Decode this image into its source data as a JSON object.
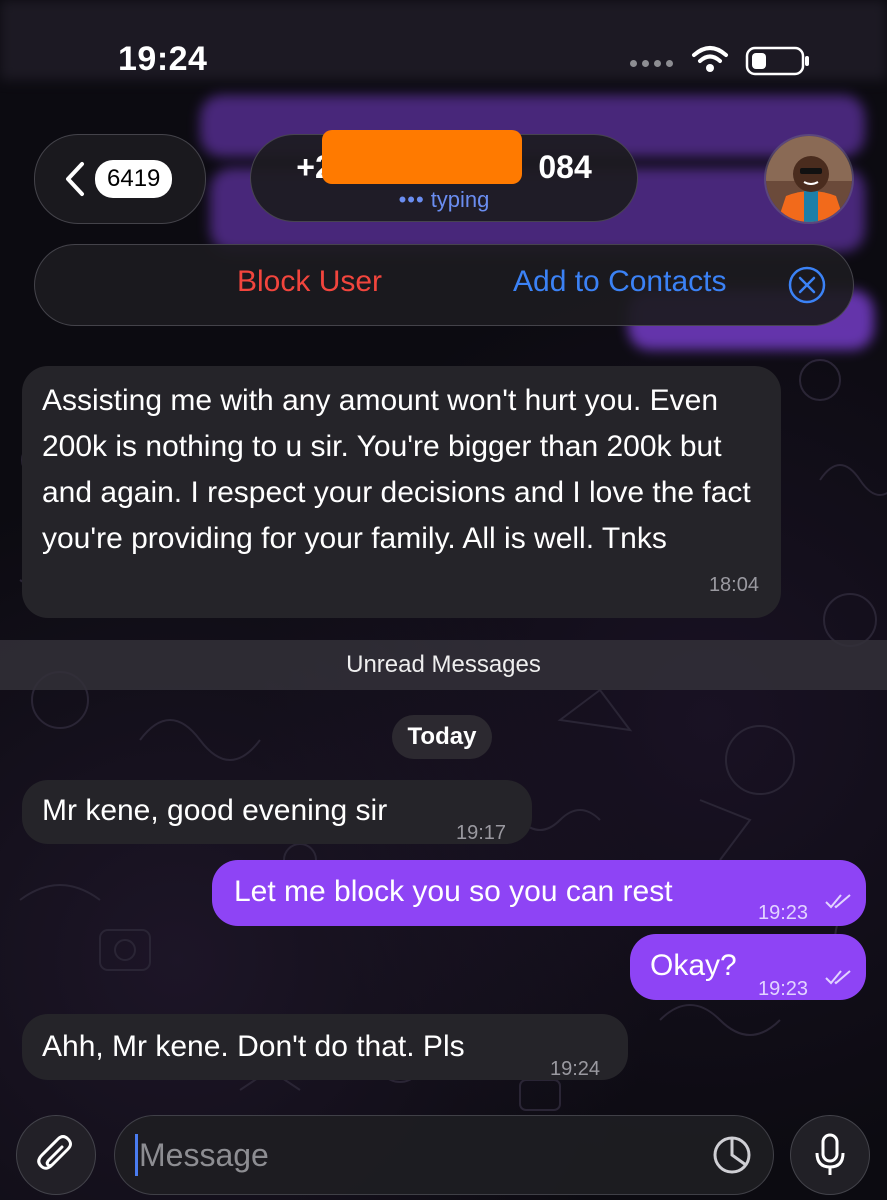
{
  "status_bar": {
    "time": "19:24"
  },
  "header": {
    "unread_count": "6419",
    "contact_phone_prefix": "+234",
    "contact_phone_suffix": "084",
    "contact_status": "typing"
  },
  "action_bar": {
    "block_label": "Block User",
    "add_label": "Add to Contacts"
  },
  "messages": [
    {
      "direction": "incoming",
      "text": "Assisting me with any amount won't hurt you. Even 200k is nothing to u sir. You're bigger than 200k but and again. I respect your decisions and I love the fact you're providing for your family. All is well. Tnks",
      "time": "18:04"
    },
    {
      "direction": "incoming",
      "text": "Mr kene, good evening sir",
      "time": "19:17"
    },
    {
      "direction": "outgoing",
      "text": "Let me block you so you can rest",
      "time": "19:23",
      "read": true
    },
    {
      "direction": "outgoing",
      "text": "Okay?",
      "time": "19:23",
      "read": true
    },
    {
      "direction": "incoming",
      "text": "Ahh, Mr kene. Don't do that. Pls",
      "time": "19:24"
    }
  ],
  "unread_divider": "Unread Messages",
  "date_chip": "Today",
  "composer": {
    "placeholder": "Message"
  },
  "colors": {
    "outgoing_bubble": "#8e44f5",
    "incoming_bubble": "#252429",
    "block_red": "#f2453d",
    "link_blue": "#3b82f6",
    "typing_blue": "#6a8df0",
    "redaction_orange": "#ff7a00"
  },
  "icons": [
    "back-chevron-icon",
    "wifi-icon",
    "battery-icon",
    "close-circle-icon",
    "read-ticks-icon",
    "attach-icon",
    "sticker-icon",
    "microphone-icon"
  ]
}
